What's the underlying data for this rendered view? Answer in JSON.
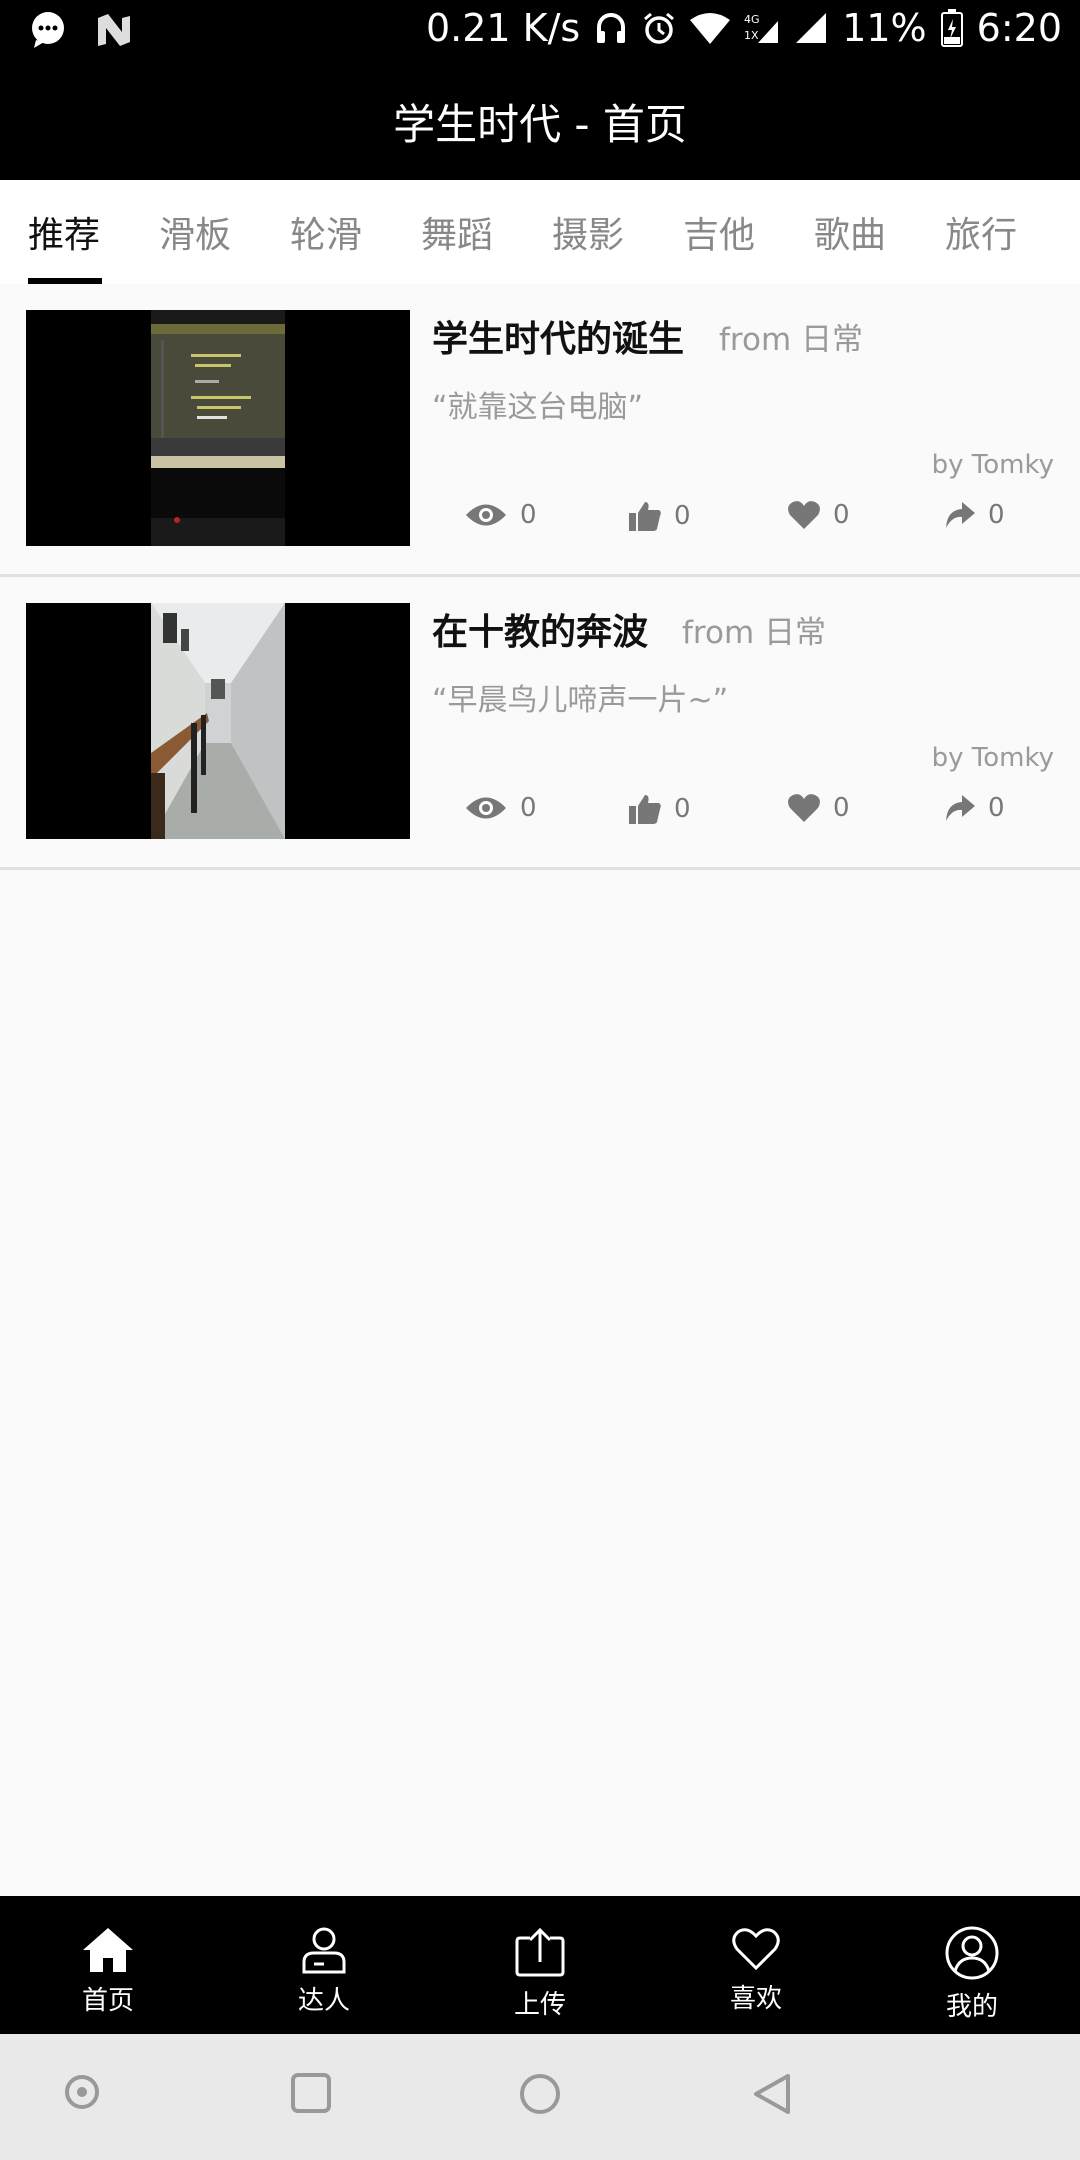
{
  "status_bar": {
    "net_speed": "0.21 K/s",
    "battery": "11%",
    "time": "6:20",
    "icons": [
      "chat-icon",
      "n-icon",
      "headphones-icon",
      "alarm-icon",
      "wifi-icon",
      "4g-icon",
      "signal-icon",
      "battery-icon"
    ]
  },
  "header": {
    "title": "学生时代 - 首页"
  },
  "tabs": [
    {
      "label": "推荐"
    },
    {
      "label": "滑板"
    },
    {
      "label": "轮滑"
    },
    {
      "label": "舞蹈"
    },
    {
      "label": "摄影"
    },
    {
      "label": "吉他"
    },
    {
      "label": "歌曲"
    },
    {
      "label": "旅行"
    }
  ],
  "active_tab": 0,
  "feed": [
    {
      "title": "学生时代的诞生",
      "from": "from 日常",
      "quote": "“就靠这台电脑”",
      "author": "by Tomky",
      "views": "0",
      "likes": "0",
      "favorites": "0",
      "shares": "0"
    },
    {
      "title": "在十教的奔波",
      "from": "from 日常",
      "quote": "“早晨鸟儿啼声一片~”",
      "author": "by Tomky",
      "views": "0",
      "likes": "0",
      "favorites": "0",
      "shares": "0"
    }
  ],
  "bottom_nav": [
    {
      "label": "首页",
      "icon": "home-icon"
    },
    {
      "label": "达人",
      "icon": "user-icon"
    },
    {
      "label": "上传",
      "icon": "upload-icon"
    },
    {
      "label": "喜欢",
      "icon": "heart-icon"
    },
    {
      "label": "我的",
      "icon": "profile-icon"
    }
  ],
  "colors": {
    "bar_bg": "#000000",
    "text_muted": "#9a9a9a",
    "accent": "#111111"
  }
}
